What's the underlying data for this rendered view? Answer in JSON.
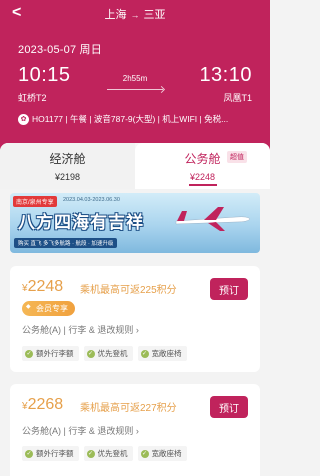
{
  "header": {
    "origin": "上海",
    "arrow": "→",
    "destination": "三亚",
    "date": "2023-05-07 周日"
  },
  "flight": {
    "departure_time": "10:15",
    "arrival_time": "13:10",
    "duration": "2h55m",
    "departure_airport": "虹桥T2",
    "arrival_airport": "凤凰T1",
    "info": "HO1177 | 午餐 | 波音787-9(大型) | 机上WIFI | 免税..."
  },
  "cabins": [
    {
      "name": "经济舱",
      "price": "¥2198"
    },
    {
      "name": "公务舱",
      "price": "¥2248",
      "badge": "超值"
    }
  ],
  "banner": {
    "tag": "南京/泉州专享",
    "dates": "2023.04.03-2023.06.30",
    "title": "八方四海有吉祥",
    "subtitle": "购买 直飞 多飞多航路 · 航段 · 加速升级"
  },
  "fares": [
    {
      "currency": "¥",
      "price": "2248",
      "points": "乘机最高可返225积分",
      "member_tag": "会员专享",
      "rules": "公务舱(A) | 行李 & 退改规则 ›",
      "book": "预订",
      "perks": [
        "额外行李额",
        "优先登机",
        "宽敞座椅"
      ]
    },
    {
      "currency": "¥",
      "price": "2268",
      "points": "乘机最高可返227积分",
      "rules": "公务舱(A) | 行李 & 退改规则 ›",
      "book": "预订",
      "perks": [
        "额外行李额",
        "优先登机",
        "宽敞座椅"
      ]
    }
  ],
  "colors": {
    "brand": "#c0235c",
    "price": "#e6a04b",
    "perk_check": "#9bbb57"
  }
}
